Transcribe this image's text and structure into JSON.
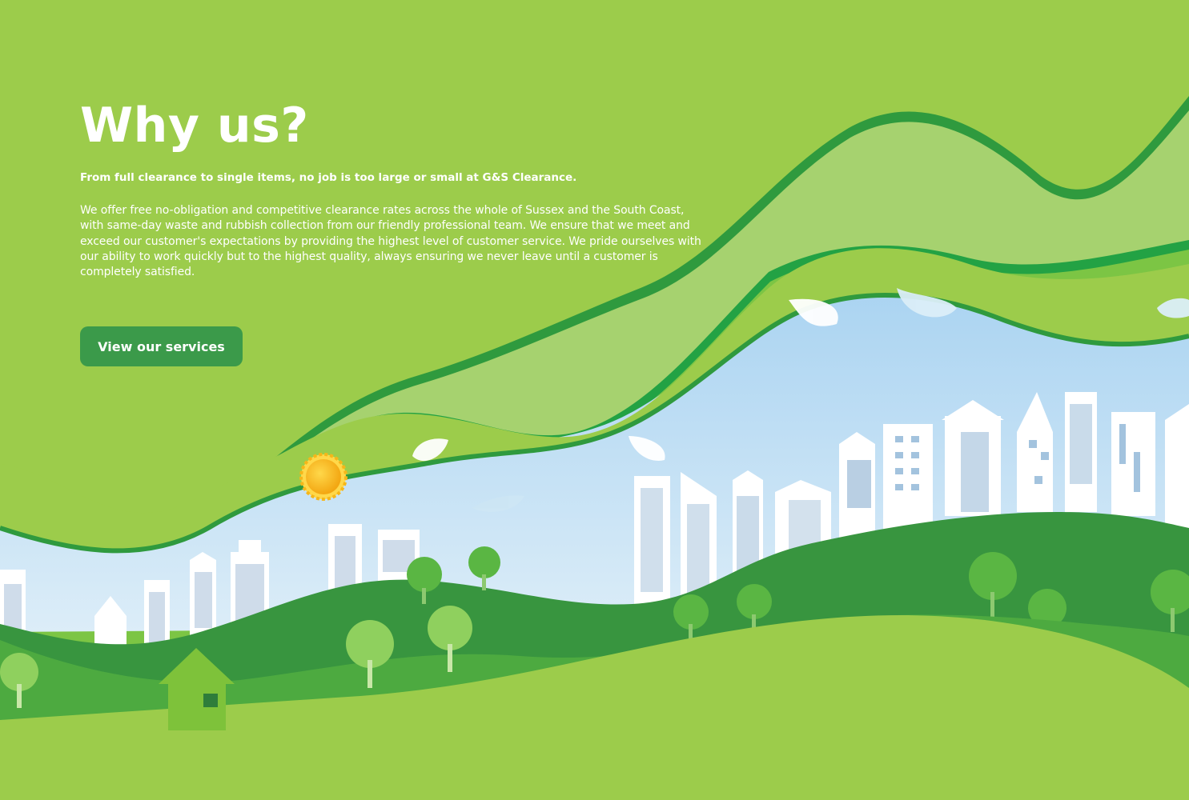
{
  "section": {
    "title": "Why us?",
    "subtitle": "From full clearance to single items, no job is too large or small at G&S Clearance.",
    "body": "We offer free no-obligation and competitive clearance rates across the whole of Sussex and the South Coast, with same-day waste and rubbish collection from our friendly professional team. We ensure that we meet and exceed our customer's expectations by providing the highest level of customer service. We pride ourselves with our ability to work quickly but to the highest quality, always ensuring we never leave until a customer is completely satisfied.",
    "cta_label": "View our services"
  },
  "colors": {
    "background": "#9ccc4b",
    "button": "#3b9a4a",
    "dark_green": "#2e8b3f",
    "mid_green": "#4cae3f",
    "sky": "#b7d9f0",
    "sun": "#f6b619"
  },
  "illustration": {
    "icons": [
      "sun-icon",
      "house-icon",
      "tree-icon",
      "leaf-icon",
      "building-icon"
    ]
  }
}
